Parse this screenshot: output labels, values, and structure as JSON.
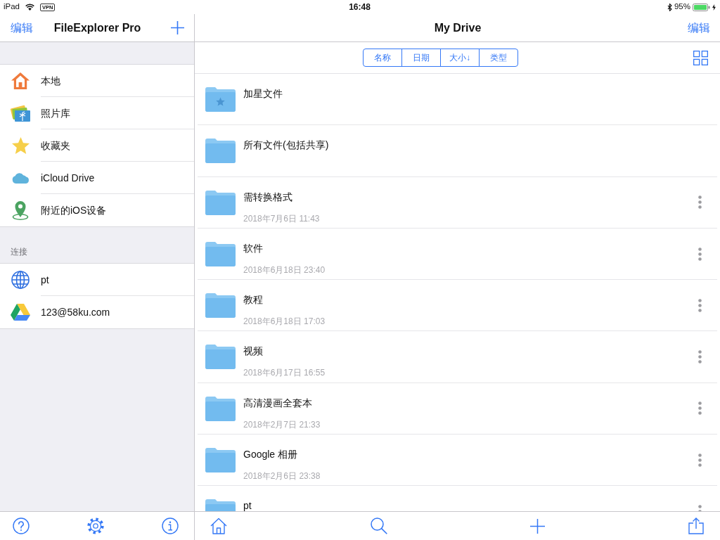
{
  "status_bar": {
    "device": "iPad",
    "vpn": "VPN",
    "time": "16:48",
    "battery": "95%"
  },
  "sidebar": {
    "edit": "编辑",
    "title": "FileExplorer Pro",
    "locations": [
      {
        "label": "本地"
      },
      {
        "label": "照片库"
      },
      {
        "label": "收藏夹"
      },
      {
        "label": "iCloud Drive"
      },
      {
        "label": "附近的iOS设备"
      }
    ],
    "section_title": "连接",
    "connections": [
      {
        "label": "pt"
      },
      {
        "label": "123@58ku.com"
      }
    ]
  },
  "main": {
    "title": "My Drive",
    "edit": "编辑",
    "sort_options": [
      "名称",
      "日期",
      "大小↓",
      "类型"
    ],
    "folders": [
      {
        "name": "加星文件",
        "starred": true,
        "more_menu": false
      },
      {
        "name": "所有文件(包括共享)",
        "starred": false,
        "more_menu": false
      },
      {
        "name": "需转换格式",
        "date": "2018年7月6日 11:43",
        "starred": false,
        "more_menu": true
      },
      {
        "name": "软件",
        "date": "2018年6月18日 23:40",
        "starred": false,
        "more_menu": true
      },
      {
        "name": "教程",
        "date": "2018年6月18日 17:03",
        "starred": false,
        "more_menu": true
      },
      {
        "name": "视频",
        "date": "2018年6月17日 16:55",
        "starred": false,
        "more_menu": true
      },
      {
        "name": "高清漫画全套本",
        "date": "2018年2月7日 21:33",
        "starred": false,
        "more_menu": true
      },
      {
        "name": "Google 相册",
        "date": "2018年2月6日 23:38",
        "starred": false,
        "more_menu": true
      },
      {
        "name": "pt",
        "starred": false,
        "more_menu": true
      }
    ]
  }
}
